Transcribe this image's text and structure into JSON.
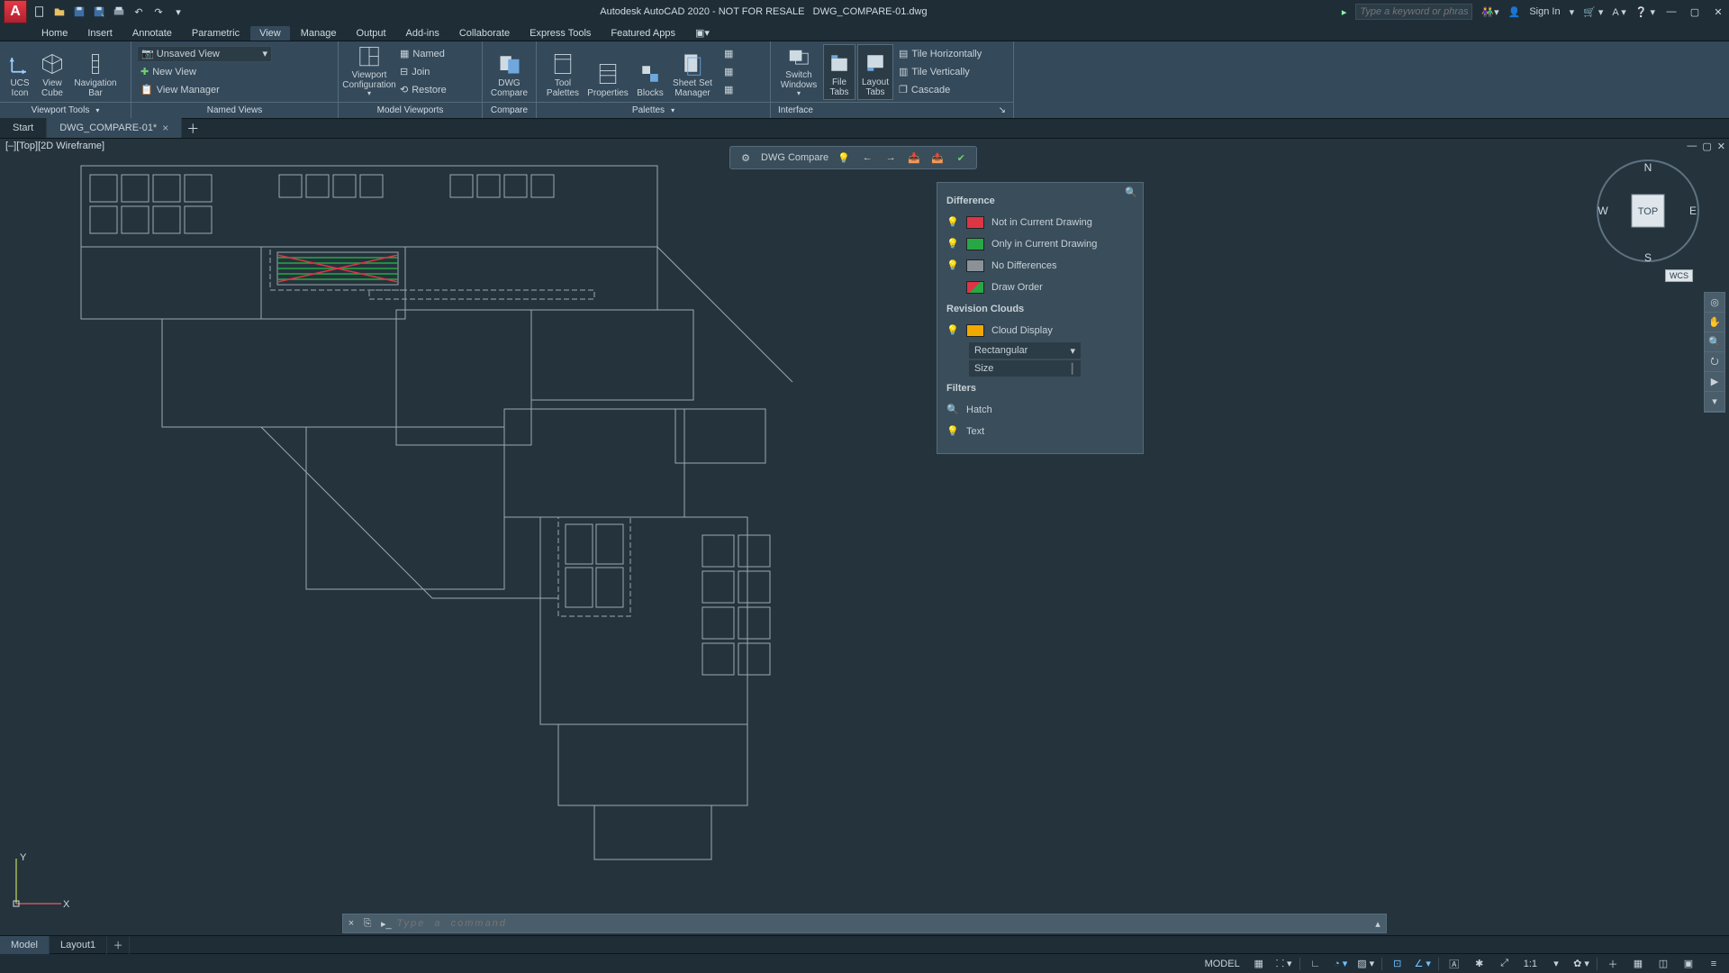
{
  "title": {
    "app": "Autodesk AutoCAD 2020 - NOT FOR RESALE",
    "file": "DWG_COMPARE-01.dwg"
  },
  "titlebar": {
    "search_placeholder": "Type a keyword or phrase",
    "sign_in": "Sign In"
  },
  "menu": {
    "items": [
      "Home",
      "Insert",
      "Annotate",
      "Parametric",
      "View",
      "Manage",
      "Output",
      "Add-ins",
      "Collaborate",
      "Express Tools",
      "Featured Apps"
    ],
    "active": "View"
  },
  "ribbon": {
    "viewport_tools": {
      "ucs": "UCS Icon",
      "viewcube": "View Cube",
      "navbar": "Navigation Bar",
      "panel": "Viewport Tools"
    },
    "named_views": {
      "unsaved": "Unsaved View",
      "newview": "New View",
      "viewmgr": "View Manager",
      "panel": "Named Views"
    },
    "model_viewports": {
      "config": "Viewport Configuration",
      "named": "Named",
      "join": "Join",
      "restore": "Restore",
      "panel": "Model Viewports"
    },
    "compare": {
      "btn": "DWG Compare",
      "panel": "Compare"
    },
    "palettes": {
      "tool": "Tool Palettes",
      "props": "Properties",
      "blocks": "Blocks",
      "sheetset": "Sheet Set Manager",
      "panel": "Palettes"
    },
    "interface": {
      "switch": "Switch Windows",
      "filetabs": "File Tabs",
      "layouttabs": "Layout Tabs",
      "tileh": "Tile Horizontally",
      "tilev": "Tile Vertically",
      "cascade": "Cascade",
      "panel": "Interface"
    }
  },
  "doctabs": {
    "start": "Start",
    "active": "DWG_COMPARE-01*"
  },
  "viewport": {
    "label": "[–][Top][2D Wireframe]"
  },
  "compare_toolbar": {
    "label": "DWG Compare"
  },
  "settings_panel": {
    "difference": "Difference",
    "not_in_current": "Not in Current Drawing",
    "only_in_current": "Only in Current Drawing",
    "no_diff": "No Differences",
    "draw_order": "Draw Order",
    "revision_clouds": "Revision Clouds",
    "cloud_display": "Cloud Display",
    "shape": "Rectangular",
    "size": "Size",
    "filters": "Filters",
    "hatch": "Hatch",
    "text": "Text"
  },
  "viewcube": {
    "top": "TOP",
    "n": "N",
    "s": "S",
    "e": "E",
    "w": "W",
    "wcs": "WCS"
  },
  "ucs": {
    "x": "X",
    "y": "Y"
  },
  "cmdline": {
    "placeholder": "Type  a  command"
  },
  "bottom": {
    "model": "Model",
    "layout1": "Layout1"
  },
  "status": {
    "model": "MODEL",
    "scale": "1:1"
  }
}
